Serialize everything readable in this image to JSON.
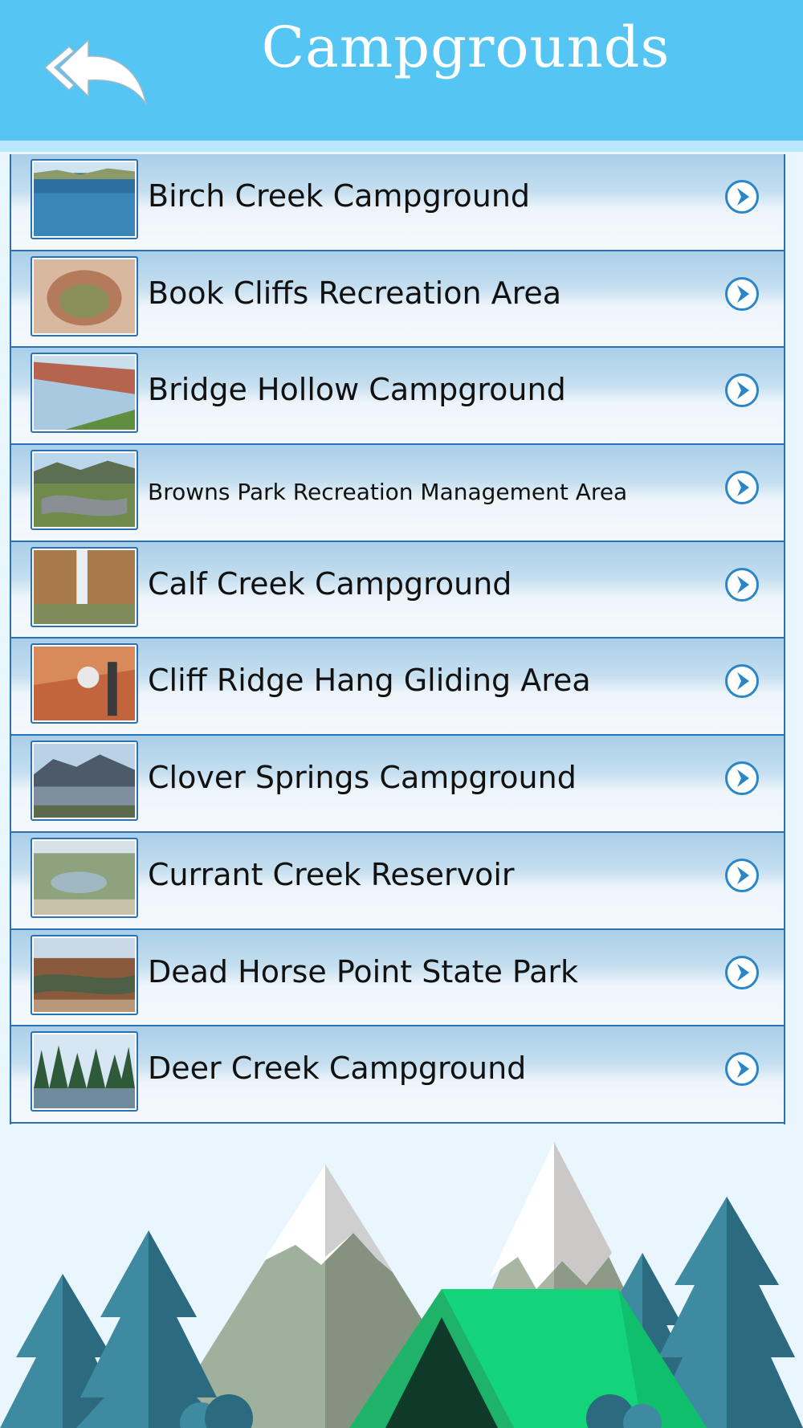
{
  "header": {
    "title": "Campgrounds",
    "bg_color": "#55c6f3"
  },
  "back_icon": "double-back-arrow-icon",
  "row_arrow_icon": "chevron-right-circle-icon",
  "items": [
    {
      "label": "Birch Creek Campground"
    },
    {
      "label": "Book Cliffs Recreation Area"
    },
    {
      "label": "Bridge Hollow Campground"
    },
    {
      "label": "Browns Park Recreation Management Area"
    },
    {
      "label": "Calf Creek Campground"
    },
    {
      "label": "Cliff Ridge Hang Gliding Area"
    },
    {
      "label": "Clover Springs Campground"
    },
    {
      "label": "Currant Creek Reservoir"
    },
    {
      "label": "Dead Horse Point State Park"
    },
    {
      "label": "Deer Creek Campground"
    }
  ],
  "footer": {
    "illustration": "mountains-trees-tent-illustration"
  }
}
